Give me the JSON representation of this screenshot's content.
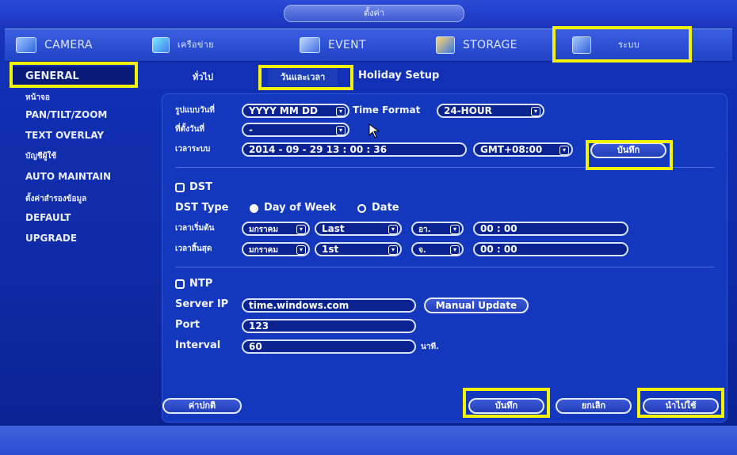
{
  "window": {
    "title": "ตั้งค่า"
  },
  "top_tabs": [
    {
      "label": "CAMERA",
      "icon": "camera-icon"
    },
    {
      "label": "เครือข่าย",
      "icon": "network-icon"
    },
    {
      "label": "EVENT",
      "icon": "event-icon"
    },
    {
      "label": "STORAGE",
      "icon": "storage-icon"
    },
    {
      "label": "ระบบ",
      "icon": "system-icon"
    }
  ],
  "sidebar": {
    "items": [
      {
        "label": "GENERAL"
      },
      {
        "label": "หน้าจอ"
      },
      {
        "label": "PAN/TILT/ZOOM"
      },
      {
        "label": "TEXT OVERLAY"
      },
      {
        "label": "บัญชีผู้ใช้"
      },
      {
        "label": "AUTO MAINTAIN"
      },
      {
        "label": "ตั้งค่าสำรองข้อมูล"
      },
      {
        "label": "DEFAULT"
      },
      {
        "label": "UPGRADE"
      }
    ]
  },
  "sub_tabs": [
    {
      "label": "ทั่วไป"
    },
    {
      "label": "วันและเวลา"
    },
    {
      "label": "Holiday Setup"
    }
  ],
  "datetime": {
    "date_format_label": "รูปแบบวันที่",
    "date_format_value": "YYYY MM DD",
    "time_format_label": "Time Format",
    "time_format_value": "24-HOUR",
    "date_separator_label": "ที่ตั้งวันที่",
    "date_separator_value": "-",
    "system_time_label": "เวลาระบบ",
    "system_time_value": "2014 - 09 - 29   13 :  00 :  36",
    "timezone_value": "GMT+08:00",
    "save_label": "บันทึก"
  },
  "dst": {
    "checkbox_label": "DST",
    "type_label": "DST Type",
    "option_day_of_week": "Day of Week",
    "option_date": "Date",
    "start_label": "เวลาเริ่มต้น",
    "start_month": "มกราคม",
    "start_week": "Last",
    "start_day": "อา.",
    "start_time": "00 :  00",
    "end_label": "เวลาสิ้นสุด",
    "end_month": "มกราคม",
    "end_week": "1st",
    "end_day": "จ.",
    "end_time": "00 :  00"
  },
  "ntp": {
    "checkbox_label": "NTP",
    "server_label": "Server IP",
    "server_value": "time.windows.com",
    "manual_update_label": "Manual Update",
    "port_label": "Port",
    "port_value": "123",
    "interval_label": "Interval",
    "interval_value": "60",
    "interval_unit": "นาที."
  },
  "footer": {
    "default_label": "ค่าปกติ",
    "save_label": "บันทึก",
    "cancel_label": "ยกเลิก",
    "apply_label": "นำไปใช้"
  },
  "colors": {
    "highlight": "#f3f307",
    "panel": "#1438bd",
    "background": "#0a1f86"
  }
}
